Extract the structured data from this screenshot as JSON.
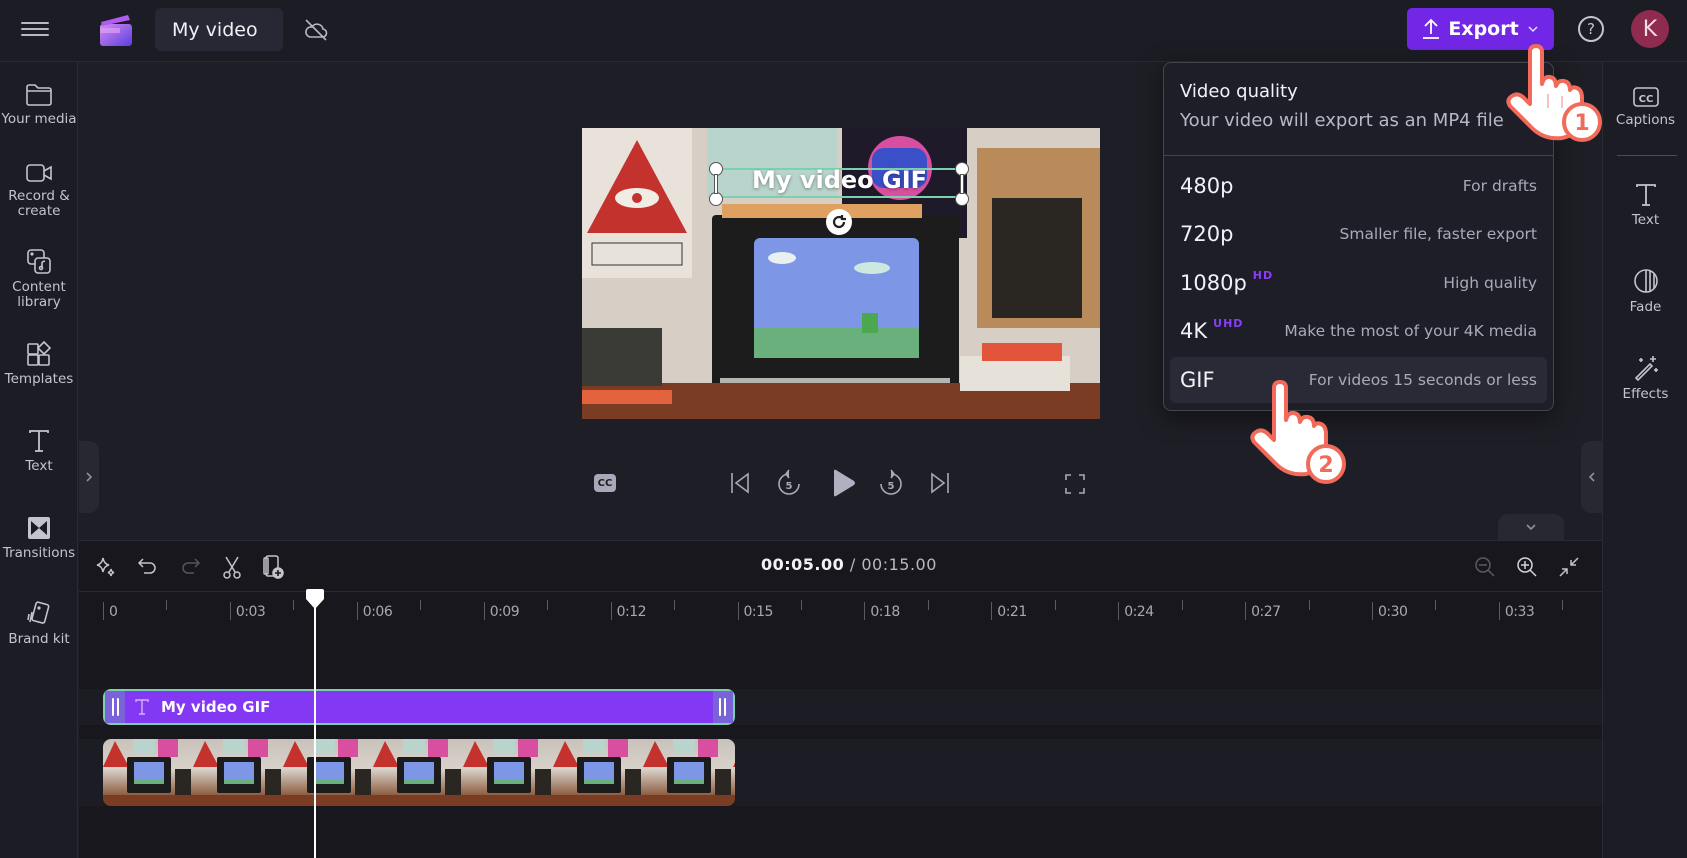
{
  "app": {
    "project_title": "My video",
    "sync_status_icon": "cloud-off-icon"
  },
  "header": {
    "export_label": "Export",
    "help_label": "?",
    "avatar_initial": "K"
  },
  "left_sidebar": {
    "items": [
      {
        "label": "Your media",
        "icon": "folder-icon"
      },
      {
        "label_line1": "Record &",
        "label_line2": "create",
        "icon": "camera-icon"
      },
      {
        "label_line1": "Content",
        "label_line2": "library",
        "icon": "content-library-icon"
      },
      {
        "label": "Templates",
        "icon": "templates-icon"
      },
      {
        "label": "Text",
        "icon": "text-icon"
      },
      {
        "label": "Transitions",
        "icon": "transitions-icon"
      },
      {
        "label": "Brand kit",
        "icon": "brand-kit-icon"
      }
    ]
  },
  "right_sidebar": {
    "items": [
      {
        "label": "Captions",
        "icon": "captions-icon"
      },
      {
        "label": "Text",
        "icon": "text-icon"
      },
      {
        "label": "Fade",
        "icon": "fade-icon"
      },
      {
        "label": "Effects",
        "icon": "effects-icon"
      }
    ]
  },
  "preview": {
    "overlay_text": "My video GIF",
    "controls": [
      "captions",
      "skip-to-start",
      "rewind-5",
      "play",
      "forward-5",
      "skip-to-end",
      "fullscreen"
    ],
    "rewind_seconds": "5",
    "forward_seconds": "5",
    "cc_label": "CC"
  },
  "export_menu": {
    "title": "Video quality",
    "subtitle": "Your video will export as an MP4 file",
    "options": [
      {
        "label": "480p",
        "badge": "",
        "description": "For drafts"
      },
      {
        "label": "720p",
        "badge": "",
        "description": "Smaller file, faster export"
      },
      {
        "label": "1080p",
        "badge": "HD",
        "description": "High quality"
      },
      {
        "label": "4K",
        "badge": "UHD",
        "description": "Make the most of your 4K media"
      },
      {
        "label": "GIF",
        "badge": "",
        "description": "For videos 15 seconds or less",
        "highlighted": true
      }
    ],
    "badge_color": "#8b3ef8"
  },
  "timeline": {
    "current_time": "00:05.00",
    "separator": " / ",
    "total_time": "00:15.00",
    "ruler_labels": [
      "0",
      "0:03",
      "0:06",
      "0:09",
      "0:12",
      "0:15",
      "0:18",
      "0:21",
      "0:24",
      "0:27",
      "0:30",
      "0:33"
    ],
    "playhead_seconds": 5,
    "clips": {
      "text_clip_label": "My video GIF",
      "text_clip_seconds": [
        0,
        15
      ],
      "video_clip_seconds": [
        0,
        15
      ]
    }
  },
  "annotations": {
    "step1": "1",
    "step2": "2"
  },
  "colors": {
    "accent": "#7227e6",
    "text_clip": "#8338f4",
    "clip_selection": "#7bd1ad",
    "avatar": "#8e2b4e",
    "annotation": "#f26a5a"
  }
}
